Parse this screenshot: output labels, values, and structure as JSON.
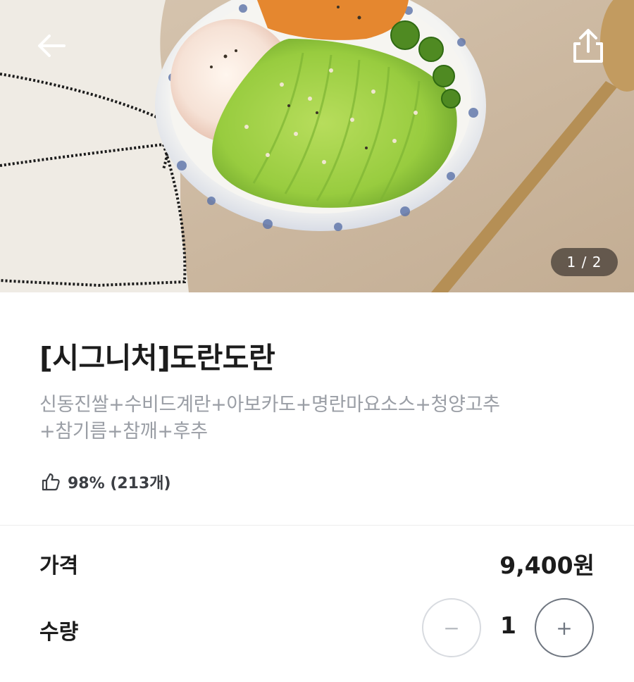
{
  "hero": {
    "page_indicator": "1 / 2",
    "back_icon": "arrow-left-icon",
    "share_icon": "share-icon"
  },
  "product": {
    "title": "[시그니처]도란도란",
    "description_lines": [
      "신동진쌀+수비드계란+아보카도+명란마요소스+청양고추",
      "+참기름+참깨+후추"
    ],
    "rating": {
      "icon": "thumbs-up-icon",
      "text": "98% (213개)"
    }
  },
  "price": {
    "label": "가격",
    "value": "9,400원"
  },
  "quantity": {
    "label": "수량",
    "value": "1",
    "minus_symbol": "−",
    "plus_symbol": "+"
  },
  "colors": {
    "text_primary": "#1c1c1c",
    "text_secondary": "#9a9ea5",
    "divider": "#ececec"
  }
}
